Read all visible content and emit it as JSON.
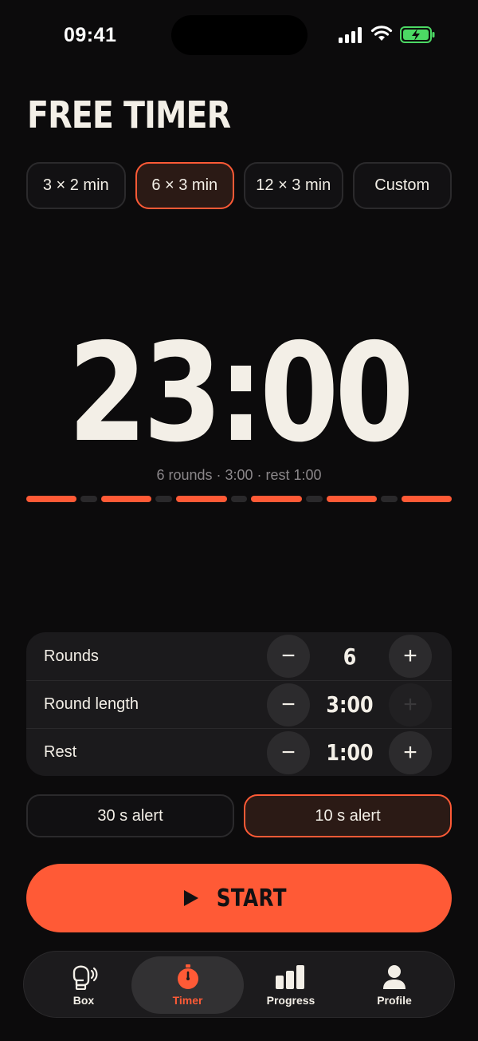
{
  "status_bar": {
    "time": "09:41"
  },
  "title": "FREE TIMER",
  "presets": [
    {
      "label": "3 × 2 min",
      "active": false
    },
    {
      "label": "6 × 3 min",
      "active": true
    },
    {
      "label": "12 × 3 min",
      "active": false
    },
    {
      "label": "Custom",
      "active": false
    }
  ],
  "timer": {
    "display": "23:00",
    "summary": "6 rounds · 3:00 · rest 1:00",
    "segments": [
      "round",
      "rest",
      "round",
      "rest",
      "round",
      "rest",
      "round",
      "rest",
      "round",
      "rest",
      "round"
    ]
  },
  "settings": {
    "rows": [
      {
        "label": "Rounds",
        "value": "6",
        "minus": "−",
        "plus": "+",
        "plus_enabled": true
      },
      {
        "label": "Round length",
        "value": "3:00",
        "minus": "−",
        "plus": "+",
        "plus_enabled": false
      },
      {
        "label": "Rest",
        "value": "1:00",
        "minus": "−",
        "plus": "+",
        "plus_enabled": true
      }
    ]
  },
  "alerts": [
    {
      "label": "30 s alert",
      "active": false
    },
    {
      "label": "10 s alert",
      "active": true
    }
  ],
  "start": {
    "label": "START",
    "icon": "play-icon"
  },
  "tabs": [
    {
      "label": "Box",
      "icon": "boxing-glove-icon",
      "active": false
    },
    {
      "label": "Timer",
      "icon": "stopwatch-icon",
      "active": true
    },
    {
      "label": "Progress",
      "icon": "bar-chart-icon",
      "active": false
    },
    {
      "label": "Profile",
      "icon": "user-icon",
      "active": false
    }
  ],
  "colors": {
    "accent": "#ff5a36",
    "background": "#0c0b0c",
    "card": "#1b1a1c",
    "text": "#f3efe7"
  }
}
